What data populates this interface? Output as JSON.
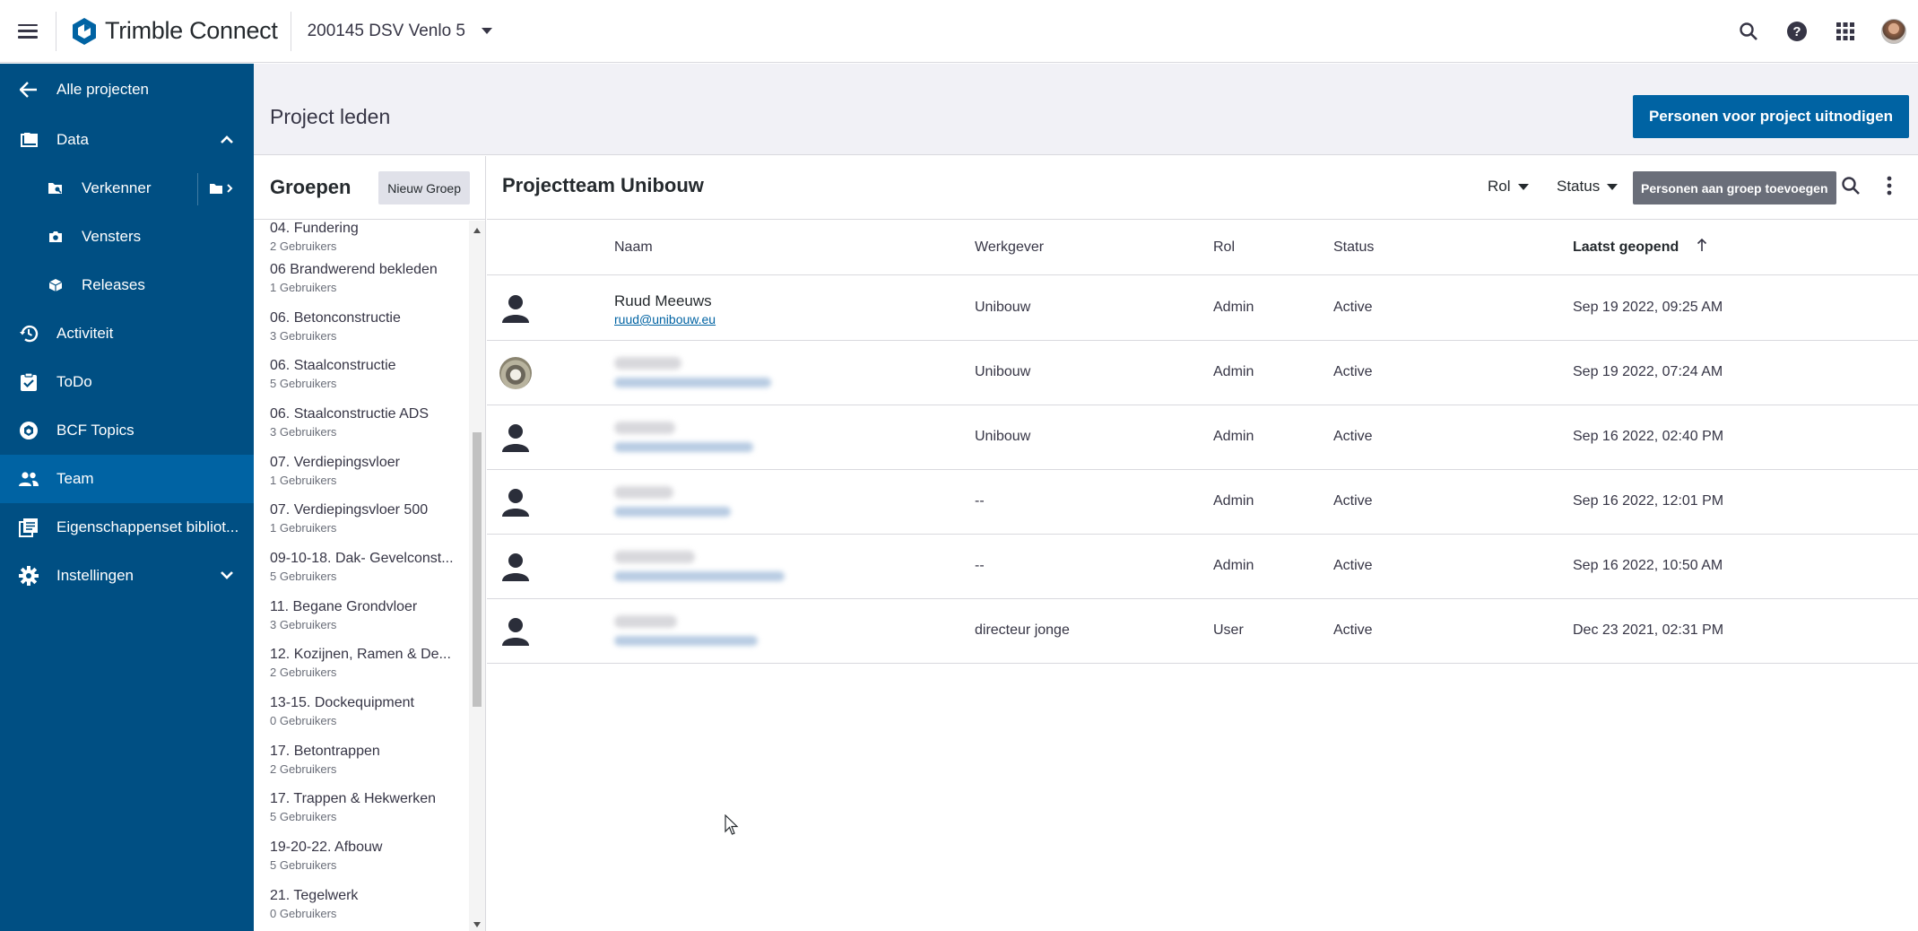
{
  "topbar": {
    "brand_name": "Trimble Connect",
    "project_name": "200145 DSV Venlo 5"
  },
  "sidebar": {
    "back": "Alle projecten",
    "data": "Data",
    "verkenner": "Verkenner",
    "vensters": "Vensters",
    "releases": "Releases",
    "activiteit": "Activiteit",
    "todo": "ToDo",
    "bcf": "BCF Topics",
    "team": "Team",
    "eigenschappen": "Eigenschappenset bibliot...",
    "instellingen": "Instellingen"
  },
  "page": {
    "title": "Project leden",
    "invite_button": "Personen voor project uitnodigen"
  },
  "groups": {
    "title": "Groepen",
    "new_button": "Nieuw Groep",
    "items": [
      {
        "name": "04. Fundering",
        "count": "2 Gebruikers"
      },
      {
        "name": "06 Brandwerend bekleden",
        "count": "1 Gebruikers"
      },
      {
        "name": "06. Betonconstructie",
        "count": "3 Gebruikers"
      },
      {
        "name": "06. Staalconstructie",
        "count": "5 Gebruikers"
      },
      {
        "name": "06. Staalconstructie ADS",
        "count": "3 Gebruikers"
      },
      {
        "name": "07. Verdiepingsvloer",
        "count": "1 Gebruikers"
      },
      {
        "name": "07. Verdiepingsvloer 500",
        "count": "1 Gebruikers"
      },
      {
        "name": "09-10-18. Dak- Gevelconst...",
        "count": "5 Gebruikers"
      },
      {
        "name": "11. Begane Grondvloer",
        "count": "3 Gebruikers"
      },
      {
        "name": "12. Kozijnen, Ramen & De...",
        "count": "2 Gebruikers"
      },
      {
        "name": "13-15. Dockequipment",
        "count": "0 Gebruikers"
      },
      {
        "name": "17. Betontrappen",
        "count": "2 Gebruikers"
      },
      {
        "name": "17. Trappen & Hekwerken",
        "count": "5 Gebruikers"
      },
      {
        "name": "19-20-22. Afbouw",
        "count": "5 Gebruikers"
      },
      {
        "name": "21. Tegelwerk",
        "count": "0 Gebruikers"
      }
    ]
  },
  "team": {
    "title": "Projectteam Unibouw",
    "filter_rol": "Rol",
    "filter_status": "Status",
    "add_button": "Personen aan groep toevoegen",
    "columns": {
      "naam": "Naam",
      "werkgever": "Werkgever",
      "rol": "Rol",
      "status": "Status",
      "laatst": "Laatst geopend"
    },
    "rows": [
      {
        "name": "Ruud Meeuws",
        "email": "ruud@unibouw.eu",
        "employer": "Unibouw",
        "role": "Admin",
        "status": "Active",
        "last": "Sep 19 2022, 09:25 AM"
      },
      {
        "employer": "Unibouw",
        "role": "Admin",
        "status": "Active",
        "last": "Sep 19 2022, 07:24 AM"
      },
      {
        "employer": "Unibouw",
        "role": "Admin",
        "status": "Active",
        "last": "Sep 16 2022, 02:40 PM"
      },
      {
        "employer": "--",
        "role": "Admin",
        "status": "Active",
        "last": "Sep 16 2022, 12:01 PM"
      },
      {
        "employer": "--",
        "role": "Admin",
        "status": "Active",
        "last": "Sep 16 2022, 10:50 AM"
      },
      {
        "employer": "directeur jonge",
        "role": "User",
        "status": "Active",
        "last": "Dec 23 2021, 02:31 PM"
      }
    ]
  }
}
